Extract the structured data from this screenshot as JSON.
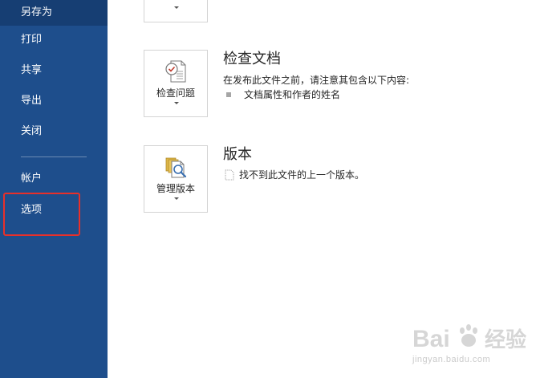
{
  "sidebar": {
    "items": [
      {
        "label": "另存为"
      },
      {
        "label": "打印"
      },
      {
        "label": "共享"
      },
      {
        "label": "导出"
      },
      {
        "label": "关闭"
      },
      {
        "label": "帐户"
      },
      {
        "label": "选项"
      }
    ]
  },
  "inspect": {
    "button_label": "检查问题",
    "title": "检查文档",
    "description": "在发布此文件之前，请注意其包含以下内容:",
    "bullets": [
      "文档属性和作者的姓名"
    ]
  },
  "versions": {
    "button_label": "管理版本",
    "title": "版本",
    "description": "找不到此文件的上一个版本。"
  },
  "watermark": {
    "logo_text": "Bai",
    "logo_text_cn": "经验",
    "url": "jingyan.baidu.com"
  },
  "colors": {
    "sidebar_bg": "#1e4e8c",
    "highlight": "#e8302a"
  }
}
